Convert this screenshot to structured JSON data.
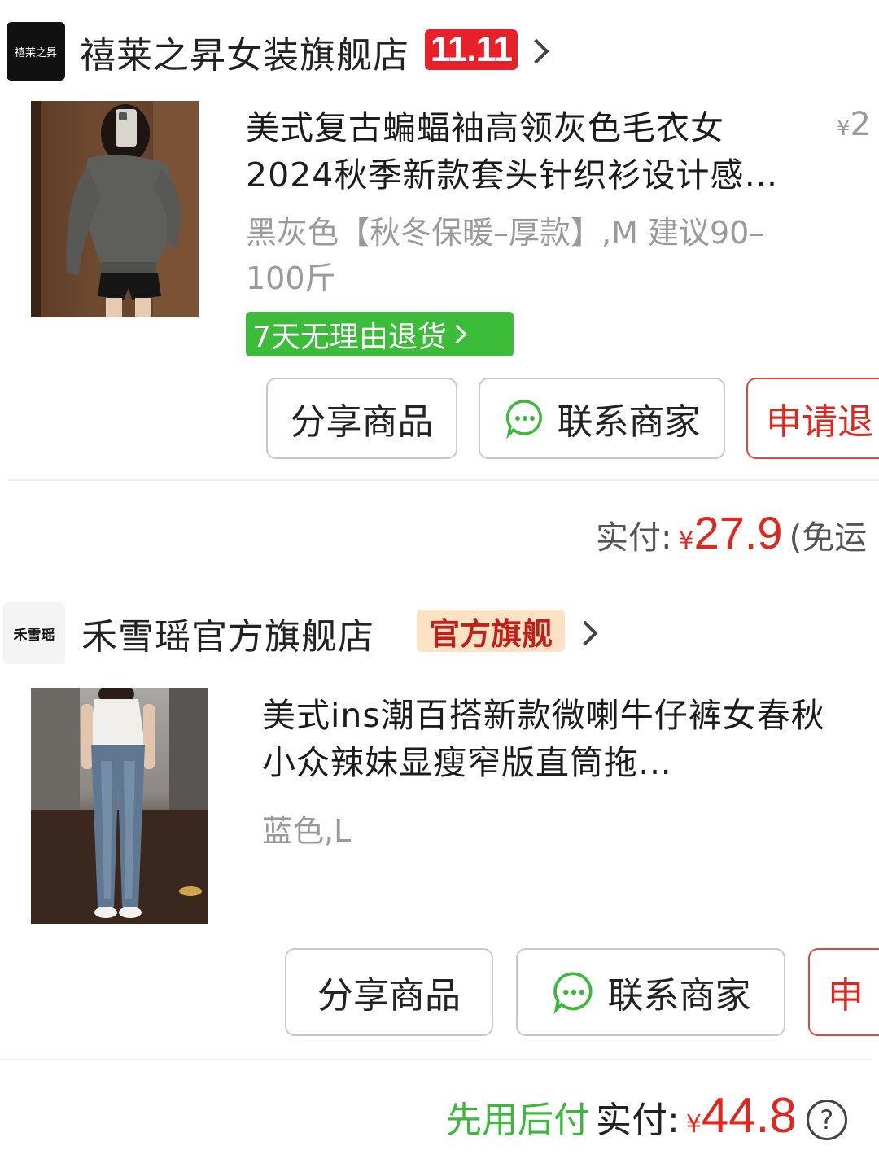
{
  "orders": [
    {
      "store": {
        "logo_text": "禧莱之昇",
        "name": "禧莱之昇女装旗舰店",
        "badge": "11.11"
      },
      "product": {
        "title": "美式复古蝙蝠袖高领灰色毛衣女2024秋季新款套头针织衫设计感…",
        "spec": "黑灰色【秋冬保暖–厚款】,M 建议90–100斤",
        "price_peek": "2",
        "return_tag": "7天无理由退货"
      },
      "buttons": {
        "share": "分享商品",
        "contact": "联系商家",
        "refund": "申请退"
      },
      "payment": {
        "label": "实付:",
        "currency": "¥",
        "amount": "27.9",
        "shipping": "(免运"
      }
    },
    {
      "store": {
        "logo_text": "禾雪瑶",
        "name": "禾雪瑶官方旗舰店",
        "badge": "官方旗舰"
      },
      "product": {
        "title": "美式ins潮百搭新款微喇牛仔裤女春秋小众辣妹显瘦窄版直筒拖…",
        "spec": "蓝色,L"
      },
      "buttons": {
        "share": "分享商品",
        "contact": "联系商家",
        "refund": "申"
      },
      "payment": {
        "pay_later": "先用后付",
        "label": "实付:",
        "currency": "¥",
        "amount": "44.8",
        "help": "?"
      }
    }
  ],
  "colors": {
    "accent_red": "#e0271d",
    "green": "#3cbd3a",
    "badge_red": "#e8202a",
    "official_bg": "#fde3c4"
  },
  "icons": {
    "chat": "chat-bubble-icon",
    "chevron": "chevron-right-icon",
    "help": "question-circle-icon"
  }
}
